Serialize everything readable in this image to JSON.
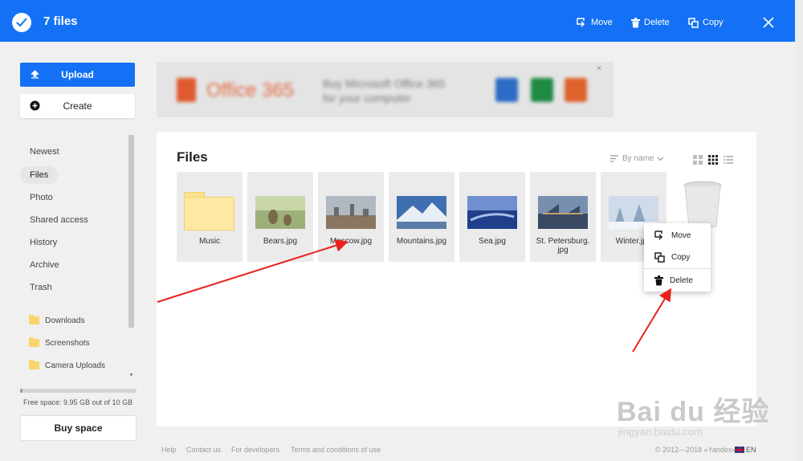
{
  "topbar": {
    "count_label": "7 files",
    "actions": {
      "move": "Move",
      "delete": "Delete",
      "copy": "Copy"
    },
    "color": "#1471f5"
  },
  "sidebar": {
    "upload_label": "Upload",
    "create_label": "Create",
    "nav": [
      "Newest",
      "Files",
      "Photo",
      "Shared access",
      "History",
      "Archive",
      "Trash"
    ],
    "active_nav": "Files",
    "folders": [
      "Downloads",
      "Screenshots",
      "Camera Uploads"
    ],
    "free_space": "Free space: 9.95 GB out of 10 GB",
    "used_fraction": 0.005,
    "buy_label": "Buy space"
  },
  "ad": {
    "brand": "Office 365",
    "copy_line1": "Buy Microsoft Office 365",
    "copy_line2": "for your computer",
    "close": "✕"
  },
  "panel": {
    "title": "Files",
    "sort_label": "By name",
    "files": [
      {
        "name": "Music",
        "kind": "folder"
      },
      {
        "name": "Bears.jpg",
        "kind": "image",
        "palette": [
          "#7a6a4a",
          "#9db07a",
          "#c8d6a8"
        ]
      },
      {
        "name": "Moscow.jpg",
        "kind": "image",
        "palette": [
          "#6a6a6a",
          "#b0b8c2",
          "#8a7560"
        ]
      },
      {
        "name": "Mountains.jpg",
        "kind": "image",
        "palette": [
          "#3f6fb0",
          "#e8eef5",
          "#5a7da8"
        ]
      },
      {
        "name": "Sea.jpg",
        "kind": "image",
        "palette": [
          "#1f3f8a",
          "#6f8fd0",
          "#a8c0e8"
        ]
      },
      {
        "name": "St. Petersburg. jpg",
        "kind": "image",
        "palette": [
          "#3a4a62",
          "#7890b0",
          "#c2a070"
        ]
      },
      {
        "name": "Winter.jpg",
        "kind": "image",
        "palette": [
          "#cfdbe8",
          "#8aa4c2",
          "#f2f5f9"
        ]
      }
    ]
  },
  "context_menu": {
    "move": "Move",
    "copy": "Copy",
    "delete": "Delete"
  },
  "footer": {
    "links": [
      "Help",
      "Contact us",
      "For developers",
      "Terms and conditions of use"
    ],
    "copyright": "© 2012—2018 «Yandex»",
    "lang": "EN"
  },
  "watermark": {
    "main": "Bai du 经验",
    "sub": "jingyan.baidu.com"
  },
  "annotation_color": "#e8221b"
}
